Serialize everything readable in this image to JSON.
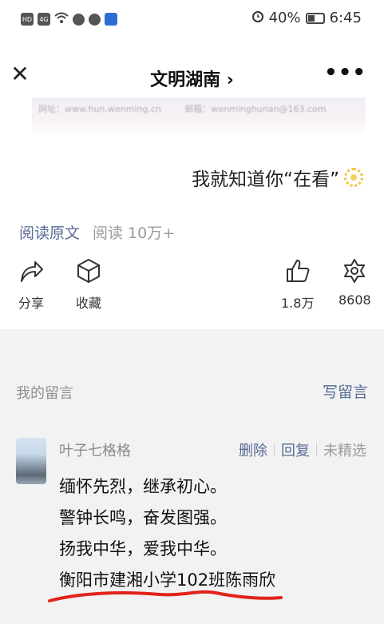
{
  "status_bar": {
    "left_icons": [
      "hd-icon",
      "signal-4g-icon",
      "wifi-icon",
      "wechat-icon",
      "chat-bubble-icon",
      "app-icon"
    ],
    "hd": "HD",
    "net": "4G",
    "battery": "40%",
    "time": "6:45"
  },
  "nav": {
    "title": "文明湖南 ›",
    "more": "•••"
  },
  "strip": {
    "text1": "网址：www.hun.wenming.cn",
    "text2": "邮箱：wenminghunan@163.com"
  },
  "knew_text": "我就知道你“在看”",
  "read": {
    "original": "阅读原文",
    "count": "阅读 10万+"
  },
  "actions": {
    "share": "分享",
    "favorite": "收藏",
    "likes": "1.8万",
    "wow": "8608"
  },
  "comments_header": {
    "label": "我的留言",
    "write": "写留言"
  },
  "comment": {
    "name": "叶子七格格",
    "delete": "删除",
    "reply": "回复",
    "featured": "未精选",
    "lines": [
      "缅怀先烈，继承初心。",
      "警钟长鸣，奋发图强。",
      "扬我中华，爱我中华。",
      "衡阳市建湘小学102班陈雨欣"
    ]
  },
  "colors": {
    "link": "#576b95",
    "underline": "#e2231a",
    "muted": "#8a8a8a"
  }
}
